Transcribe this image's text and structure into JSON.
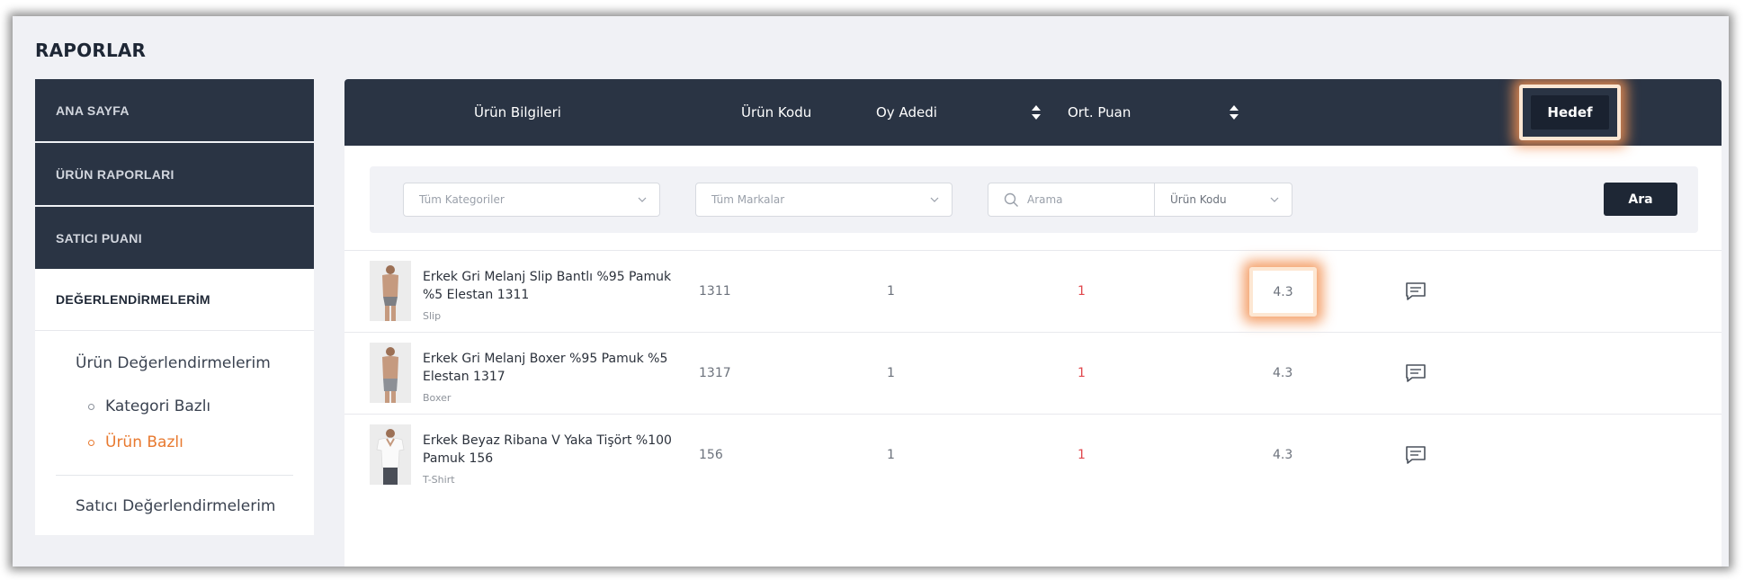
{
  "page_title": "RAPORLAR",
  "sidebar": {
    "dark_items": [
      {
        "label": "ANA SAYFA"
      },
      {
        "label": "ÜRÜN RAPORLARI"
      },
      {
        "label": "SATICI PUANI"
      }
    ],
    "active_item": "DEĞERLENDİRMELERİM",
    "sub_heading": "Ürün Değerlendirmelerim",
    "sub_items": [
      {
        "label": "Kategori Bazlı",
        "active": false
      },
      {
        "label": "Ürün Bazlı",
        "active": true
      }
    ],
    "sub_heading_2": "Satıcı Değerlendirmelerim"
  },
  "table": {
    "columns": {
      "product_info": "Ürün Bilgileri",
      "product_code": "Ürün Kodu",
      "vote_count": "Oy Adedi",
      "avg_score": "Ort. Puan",
      "target": "Hedef"
    },
    "filters": {
      "category_placeholder": "Tüm Kategoriler",
      "brand_placeholder": "Tüm Markalar",
      "search_placeholder": "Arama",
      "search_type": "Ürün Kodu",
      "search_button": "Ara"
    },
    "rows": [
      {
        "name": "Erkek Gri Melanj Slip Bantlı %95 Pamuk %5 Elestan 1311",
        "category": "Slip",
        "code": "1311",
        "votes": "1",
        "avg": "1",
        "target": "4.3"
      },
      {
        "name": "Erkek Gri Melanj Boxer %95 Pamuk %5 Elestan 1317",
        "category": "Boxer",
        "code": "1317",
        "votes": "1",
        "avg": "1",
        "target": "4.3"
      },
      {
        "name": "Erkek Beyaz Ribana V Yaka Tişört %100 Pamuk 156",
        "category": "T-Shirt",
        "code": "156",
        "votes": "1",
        "avg": "1",
        "target": "4.3"
      }
    ]
  },
  "colors": {
    "dark_navy": "#2a3444",
    "accent_orange": "#e8792f",
    "avg_red": "#e0474d",
    "highlight_glow": "#f29254"
  },
  "icons": [
    "sort-icon",
    "search-icon",
    "chevron-down-icon",
    "comment-icon"
  ]
}
